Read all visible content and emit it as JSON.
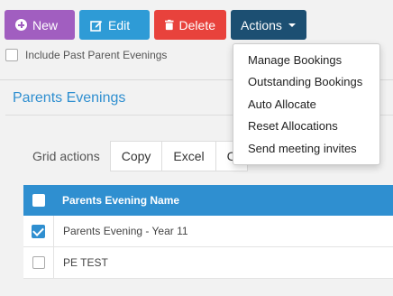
{
  "toolbar": {
    "new_label": "New",
    "edit_label": "Edit",
    "delete_label": "Delete",
    "actions_label": "Actions"
  },
  "filter": {
    "include_past_label": "Include Past Parent Evenings",
    "include_past_checked": false
  },
  "panel": {
    "title": "Parents Evenings"
  },
  "grid_actions": {
    "label": "Grid actions",
    "buttons": [
      "Copy",
      "Excel",
      "C"
    ]
  },
  "grid": {
    "column_header": "Parents Evening Name",
    "rows": [
      {
        "name": "Parents Evening - Year 11",
        "checked": true
      },
      {
        "name": "PE TEST",
        "checked": false
      }
    ]
  },
  "actions_menu": {
    "items": [
      "Manage Bookings",
      "Outstanding Bookings",
      "Auto Allocate",
      "Reset Allocations",
      "Send meeting invites"
    ]
  },
  "colors": {
    "accent": "#2f8fd0",
    "new": "#a15ec0",
    "edit": "#2e9bd6",
    "delete": "#e8423c",
    "actions": "#1c4f72"
  }
}
